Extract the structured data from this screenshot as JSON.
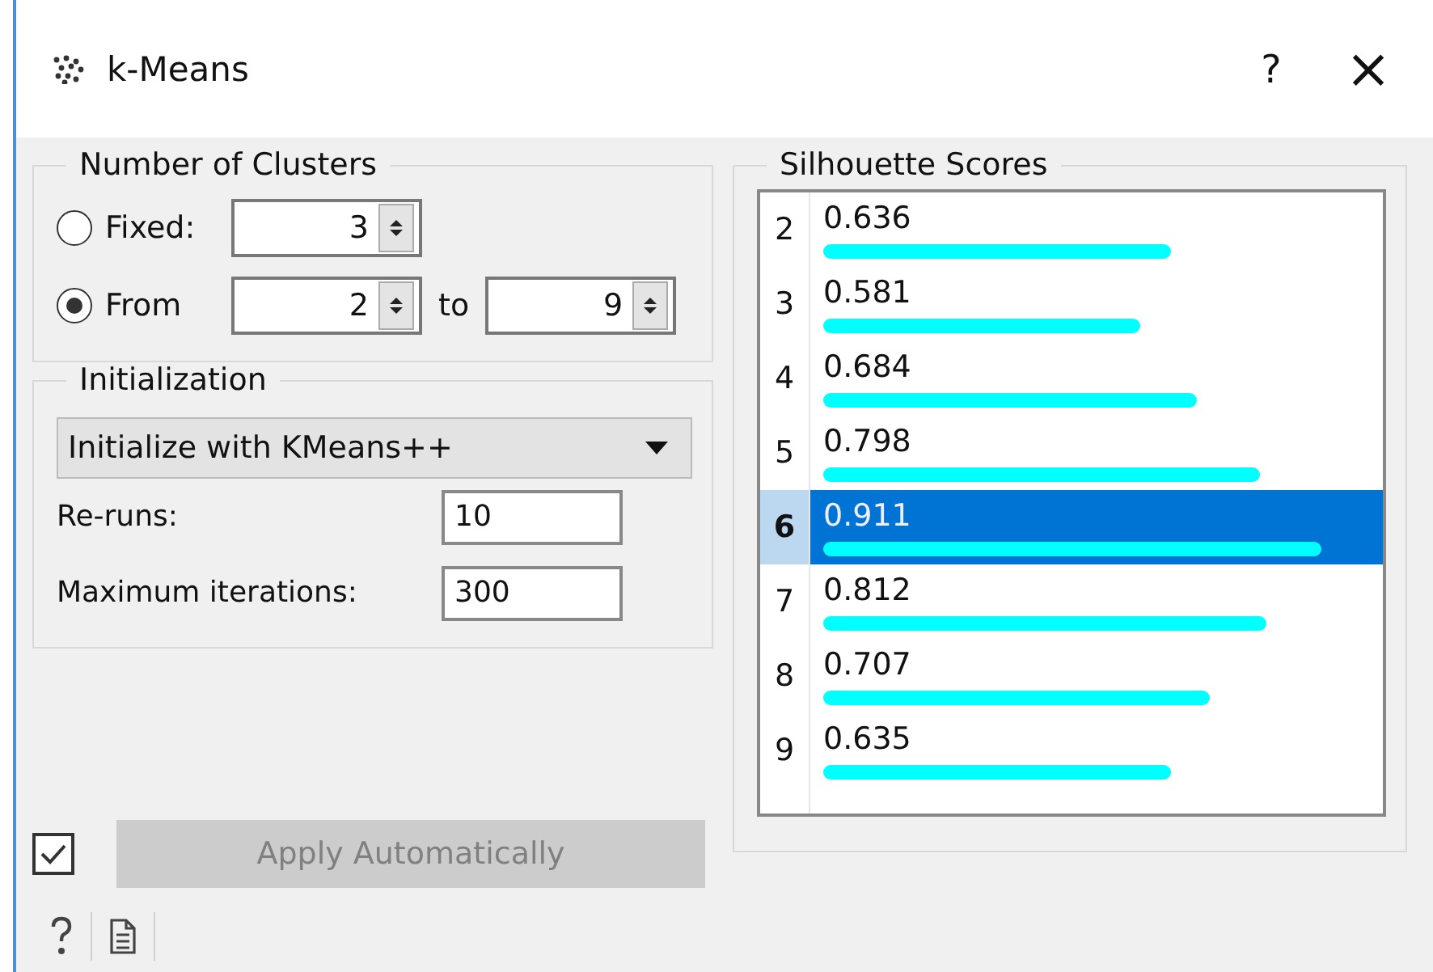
{
  "window": {
    "title": "k-Means",
    "help": "?",
    "close": "×"
  },
  "clusters": {
    "title": "Number of Clusters",
    "options": [
      {
        "label": "Fixed:",
        "selected": false
      },
      {
        "label": "From",
        "selected": true
      }
    ],
    "fixed_value": "3",
    "from_value": "2",
    "to_label": "to",
    "to_value": "9"
  },
  "initialization": {
    "title": "Initialization",
    "method": "Initialize with KMeans++",
    "reruns_label": "Re-runs:",
    "reruns": "10",
    "max_iter_label": "Maximum iterations:",
    "max_iter": "300"
  },
  "silhouette": {
    "title": "Silhouette Scores",
    "rows": [
      {
        "k": "2",
        "score": "0.636",
        "selected": false
      },
      {
        "k": "3",
        "score": "0.581",
        "selected": false
      },
      {
        "k": "4",
        "score": "0.684",
        "selected": false
      },
      {
        "k": "5",
        "score": "0.798",
        "selected": false
      },
      {
        "k": "6",
        "score": "0.911",
        "selected": true
      },
      {
        "k": "7",
        "score": "0.812",
        "selected": false
      },
      {
        "k": "8",
        "score": "0.707",
        "selected": false
      },
      {
        "k": "9",
        "score": "0.635",
        "selected": false
      }
    ]
  },
  "apply": {
    "checked": true,
    "label": "Apply Automatically",
    "disabled": true
  }
}
